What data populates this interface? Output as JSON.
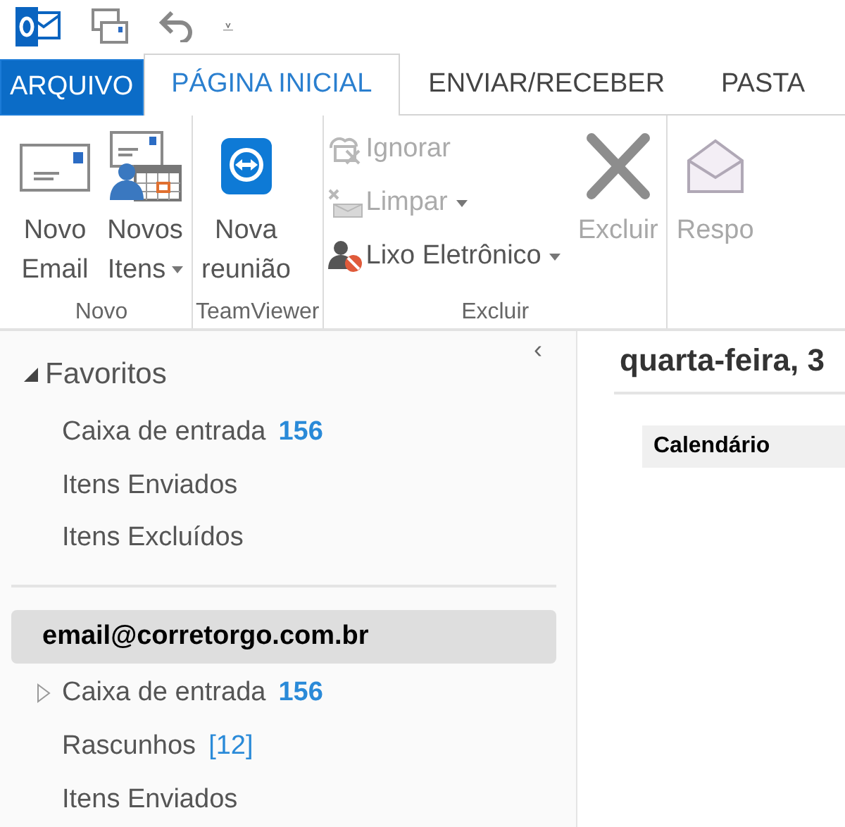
{
  "quick_access": {
    "customize_glyph": "⩡"
  },
  "tabs": [
    {
      "label": "ARQUIVO",
      "kind": "file",
      "selected": false
    },
    {
      "label": "PÁGINA INICIAL",
      "kind": "tab",
      "selected": true
    },
    {
      "label": "ENVIAR/RECEBER",
      "kind": "tab",
      "selected": false
    },
    {
      "label": "PASTA",
      "kind": "tab",
      "selected": false
    }
  ],
  "ribbon": {
    "groups": [
      {
        "label": "Novo",
        "buttons": [
          {
            "kind": "large",
            "lines": [
              "Novo",
              "Email"
            ],
            "dropdown": false,
            "disabled": false
          },
          {
            "kind": "large",
            "lines": [
              "Novos",
              "Itens"
            ],
            "dropdown": true,
            "disabled": false
          }
        ]
      },
      {
        "label": "TeamViewer",
        "buttons": [
          {
            "kind": "large",
            "lines": [
              "Nova",
              "reunião"
            ],
            "dropdown": false,
            "disabled": false
          }
        ]
      },
      {
        "label": "Excluir",
        "buttons": [
          {
            "kind": "stack",
            "items": [
              {
                "label": "Ignorar",
                "dropdown": false,
                "disabled": true
              },
              {
                "label": "Limpar",
                "dropdown": true,
                "disabled": true
              },
              {
                "label": "Lixo Eletrônico",
                "dropdown": true,
                "disabled": false
              }
            ]
          },
          {
            "kind": "large",
            "lines": [
              "Excluir"
            ],
            "dropdown": false,
            "disabled": true
          }
        ]
      },
      {
        "buttons": [
          {
            "kind": "large",
            "lines": [
              "Respo"
            ],
            "dropdown": false,
            "disabled": true
          }
        ]
      }
    ]
  },
  "sidebar": {
    "collapse_glyph": "‹",
    "favorites": {
      "label": "Favoritos",
      "expanded": true,
      "items": [
        {
          "label": "Caixa de entrada",
          "count": "156",
          "count_bold": true
        },
        {
          "label": "Itens Enviados"
        },
        {
          "label": "Itens Excluídos"
        }
      ]
    },
    "account": {
      "label": "email@corretorgo.com.br",
      "selected": true,
      "items": [
        {
          "label": "Caixa de entrada",
          "count": "156",
          "count_bold": true,
          "expanded": false
        },
        {
          "label": "Rascunhos",
          "count": "[12]",
          "count_bold": false
        },
        {
          "label": "Itens Enviados"
        }
      ]
    }
  },
  "content": {
    "date_heading": "quarta-feira, 3",
    "calendar_header": "Calendário"
  }
}
